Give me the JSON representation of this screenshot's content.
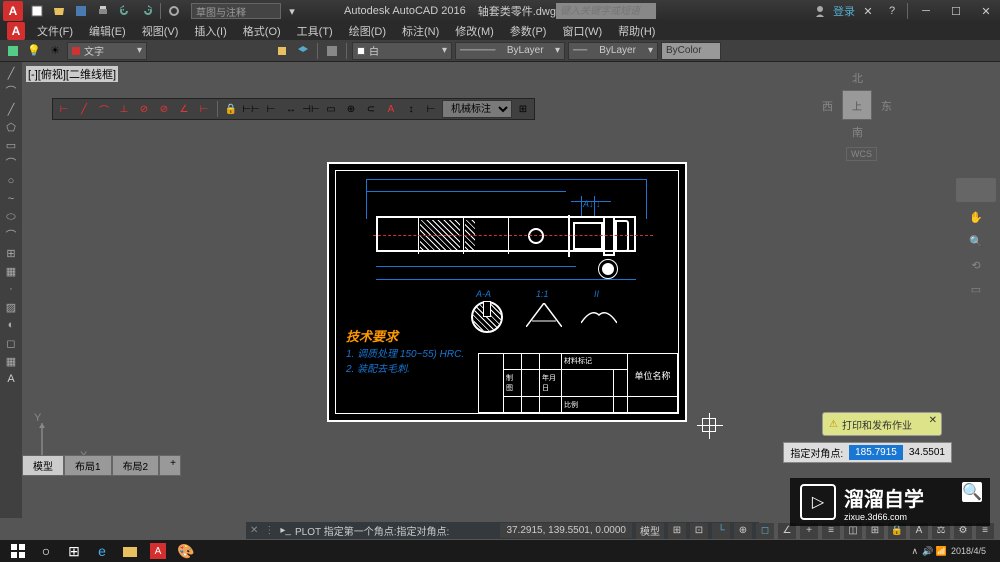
{
  "title": {
    "app": "Autodesk AutoCAD 2016",
    "filename": "轴套类零件.dwg"
  },
  "title_search": {
    "placeholder": "键入关键字或短语",
    "workspace": "草图与注释"
  },
  "login": "登录",
  "menu": [
    "文件(F)",
    "编辑(E)",
    "视图(V)",
    "插入(I)",
    "格式(O)",
    "工具(T)",
    "绘图(D)",
    "标注(N)",
    "修改(M)",
    "参数(P)",
    "窗口(W)",
    "帮助(H)"
  ],
  "layer": {
    "current": "文字"
  },
  "props": {
    "linetype": "ByLayer",
    "lineweight": "ByLayer",
    "color": "ByColor",
    "white": "白"
  },
  "view_label": "[-][俯视][二维线框]",
  "dim_style": "机械标注",
  "viewcube": {
    "n": "北",
    "s": "南",
    "e": "东",
    "w": "西",
    "top": "上"
  },
  "wcs": "WCS",
  "tech": {
    "title": "技术要求",
    "line1": "1. 调质处理 150~55) HRC.",
    "line2": "2. 装配去毛刺."
  },
  "section": {
    "aa": "A-A"
  },
  "titleblock": {
    "company": "单位名称",
    "drawer": "制图",
    "date": "年月日",
    "scale": "比例",
    "material": "材料标记"
  },
  "coord_prompt": {
    "label": "指定对角点:",
    "x": "185.7915",
    "y": "34.5501"
  },
  "cmdline": {
    "prefix": "PLOT 指定第一个角点:",
    "text": "指定对角点:"
  },
  "tabs": [
    "模型",
    "布局1",
    "布局2"
  ],
  "status": {
    "coords": "37.2915, 139.5501, 0.0000",
    "mode": "模型"
  },
  "balloon": "打印和发布作业",
  "ucs": {
    "x": "X",
    "y": "Y"
  },
  "watermark": {
    "brand": "溜溜自学",
    "url": "zixue.3d66.com"
  },
  "taskbar": {
    "date": "2018/4/5"
  }
}
